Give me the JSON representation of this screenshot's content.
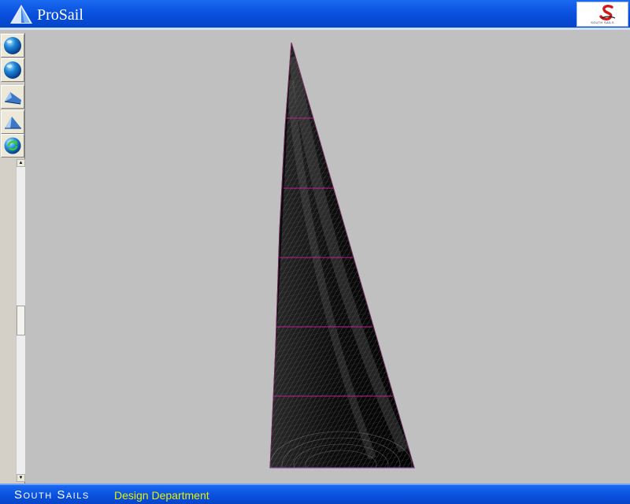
{
  "app": {
    "title": "ProSail",
    "brand_text": "SOUTH SAILS"
  },
  "toolbar": {
    "buttons": [
      {
        "name": "globe-view-button",
        "icon": "globe-icon"
      },
      {
        "name": "globe-rotate-button",
        "icon": "globe-icon"
      },
      {
        "name": "sail-side-view-button",
        "icon": "sail-shape-icon"
      },
      {
        "name": "sail-front-view-button",
        "icon": "sail-shape-icon"
      },
      {
        "name": "refresh-button",
        "icon": "refresh-globe-icon"
      }
    ]
  },
  "scrollbar": {
    "up_arrow": "▲",
    "down_arrow": "▼"
  },
  "footer": {
    "company": "South Sails",
    "department": "Design Department"
  },
  "colors": {
    "title_bar": "#0a50de",
    "footer_text": "#e8f000",
    "canvas_bg": "#c0c0c0",
    "seam_line": "#c02090"
  }
}
